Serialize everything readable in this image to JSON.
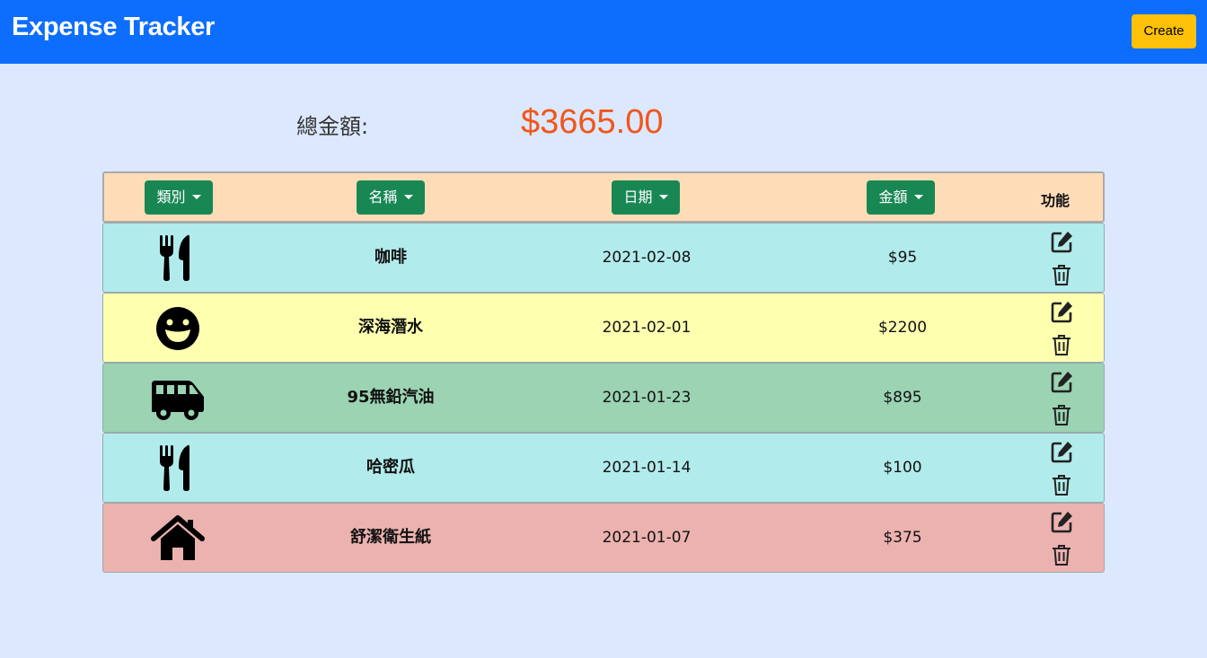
{
  "header": {
    "title": "Expense Tracker",
    "create_label": "Create"
  },
  "summary": {
    "total_label": "總金額:",
    "total_value": "$3665.00"
  },
  "table": {
    "sort_buttons": [
      "類別",
      "名稱",
      "日期",
      "金額"
    ],
    "function_header": "功能",
    "rows": [
      {
        "category_icon": "utensils-icon",
        "name": "咖啡",
        "date": "2021-02-08",
        "amount": "$95",
        "bg": "#b2ebeb"
      },
      {
        "category_icon": "grin-icon",
        "name": "深海潛水",
        "date": "2021-02-01",
        "amount": "$2200",
        "bg": "#ffffb0"
      },
      {
        "category_icon": "shuttle-van-icon",
        "name": "95無鉛汽油",
        "date": "2021-01-23",
        "amount": "$895",
        "bg": "#9bd3b3"
      },
      {
        "category_icon": "utensils-icon",
        "name": "哈密瓜",
        "date": "2021-01-14",
        "amount": "$100",
        "bg": "#b2ebeb"
      },
      {
        "category_icon": "home-icon",
        "name": "舒潔衛生紙",
        "date": "2021-01-07",
        "amount": "$375",
        "bg": "#ecb2b0"
      }
    ]
  },
  "colors": {
    "navbar": "#0d6efd",
    "create_button": "#ffc107",
    "sort_button": "#198754",
    "total_value": "#f1561a",
    "header_row": "#ffdcb8",
    "page_bg": "#dce8fe"
  }
}
